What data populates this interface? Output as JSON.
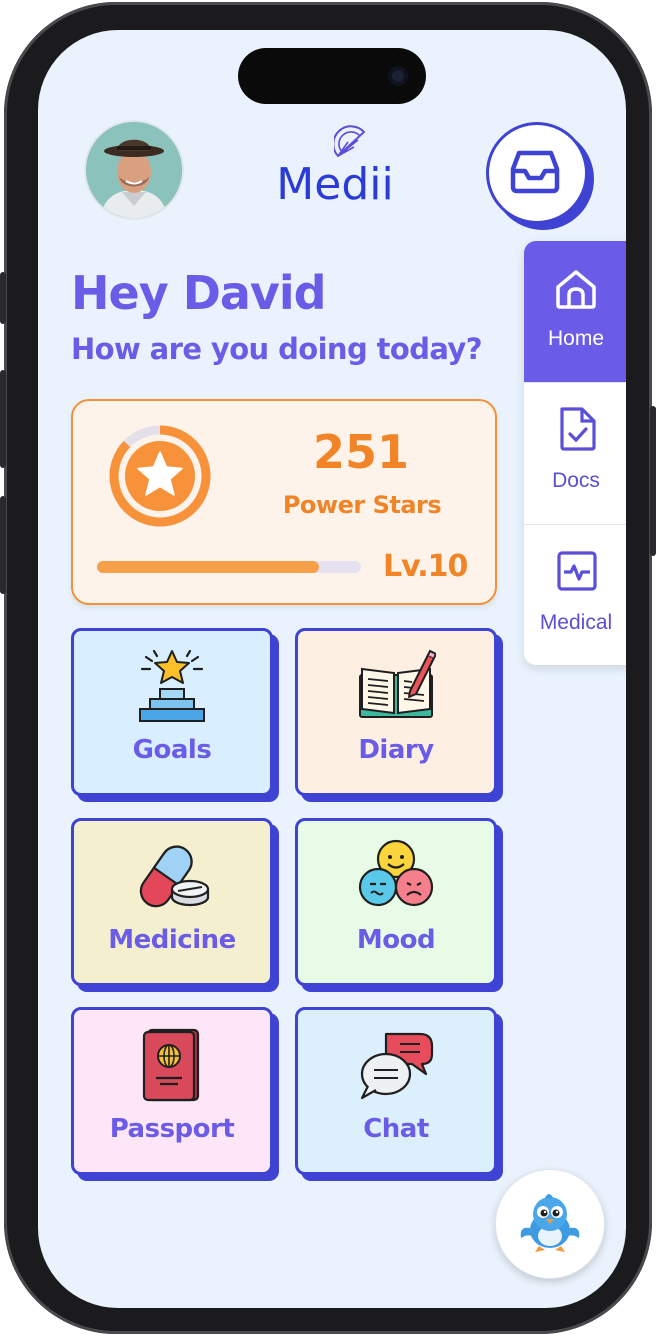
{
  "app": {
    "logo_text": "Medii"
  },
  "header": {
    "avatar_alt": "User avatar",
    "inbox_icon": "inbox-icon"
  },
  "greeting": {
    "title": "Hey David",
    "subtitle": "How are you doing today?"
  },
  "stars": {
    "count": "251",
    "label": "Power Stars",
    "level": "Lv.10",
    "progress": 0.84,
    "accent_color": "#f08426"
  },
  "nav": {
    "items": [
      {
        "label": "Home",
        "icon": "home-icon",
        "active": true
      },
      {
        "label": "Docs",
        "icon": "document-check-icon",
        "active": false
      },
      {
        "label": "Medical",
        "icon": "heartbeat-monitor-icon",
        "active": false
      }
    ]
  },
  "tiles": [
    {
      "label": "Goals",
      "icon": "podium-star-icon",
      "color": "#d9efff"
    },
    {
      "label": "Diary",
      "icon": "open-book-pencil-icon",
      "color": "#fdf0e3"
    },
    {
      "label": "Medicine",
      "icon": "pill-capsule-icon",
      "color": "#f3efcf"
    },
    {
      "label": "Mood",
      "icon": "mood-faces-icon",
      "color": "#e7fbe6"
    },
    {
      "label": "Passport",
      "icon": "passport-icon",
      "color": "#fde6f8"
    },
    {
      "label": "Chat",
      "icon": "chat-bubbles-icon",
      "color": "#dceffd"
    }
  ],
  "assistant": {
    "icon": "bird-mascot-icon"
  },
  "colors": {
    "primary": "#6b5ce7",
    "border": "#3e43d3",
    "background": "#eaf3fd"
  }
}
